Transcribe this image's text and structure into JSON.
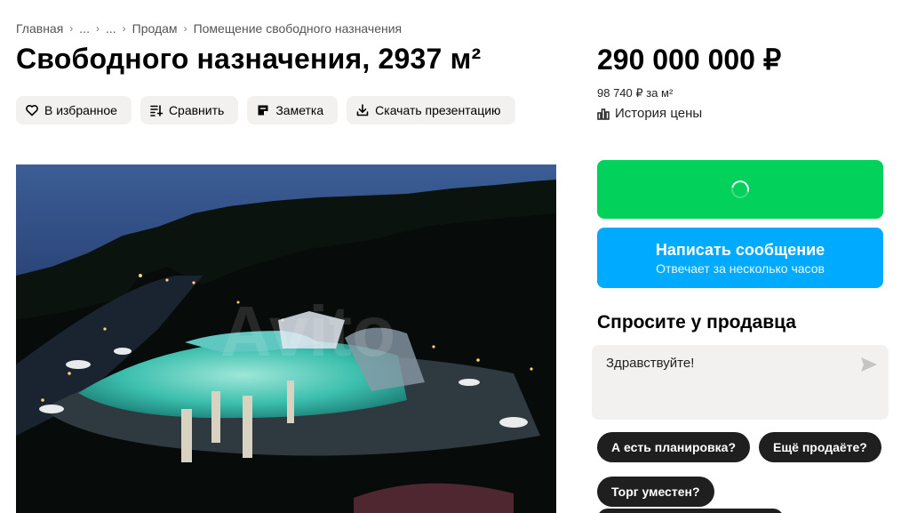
{
  "breadcrumbs": [
    "Главная",
    "...",
    "...",
    "Продам",
    "Помещение свободного назначения"
  ],
  "listing": {
    "title": "Свободного назначения, 2937 м²",
    "price": "290 000 000 ₽",
    "price_per_meter": "98 740 ₽ за м²",
    "price_history_label": "История цены"
  },
  "actions": {
    "favorite_label": "В избранное",
    "compare_label": "Сравнить",
    "note_label": "Заметка",
    "download_label": "Скачать презентацию"
  },
  "contact": {
    "call_loading": true,
    "message_label": "Написать сообщение",
    "message_sub": "Отвечает за несколько часов"
  },
  "ask": {
    "title": "Спросите у продавца",
    "input_value": "Здравствуйте!",
    "chips": [
      "А есть планировка?",
      "Ещё продаёте?",
      "Торг уместен?"
    ]
  },
  "photo": {
    "watermark": "Avito"
  },
  "colors": {
    "call_button": "#02d15c",
    "message_button": "#00aaff",
    "chip_bg": "#1f1f1f",
    "action_bg": "#f2f1f0"
  },
  "icons": {
    "favorite": "heart-icon",
    "compare": "compare-list-icon",
    "note": "note-icon",
    "download": "download-icon",
    "history": "bar-chart-icon",
    "send": "send-icon",
    "loading": "spinner-icon"
  }
}
